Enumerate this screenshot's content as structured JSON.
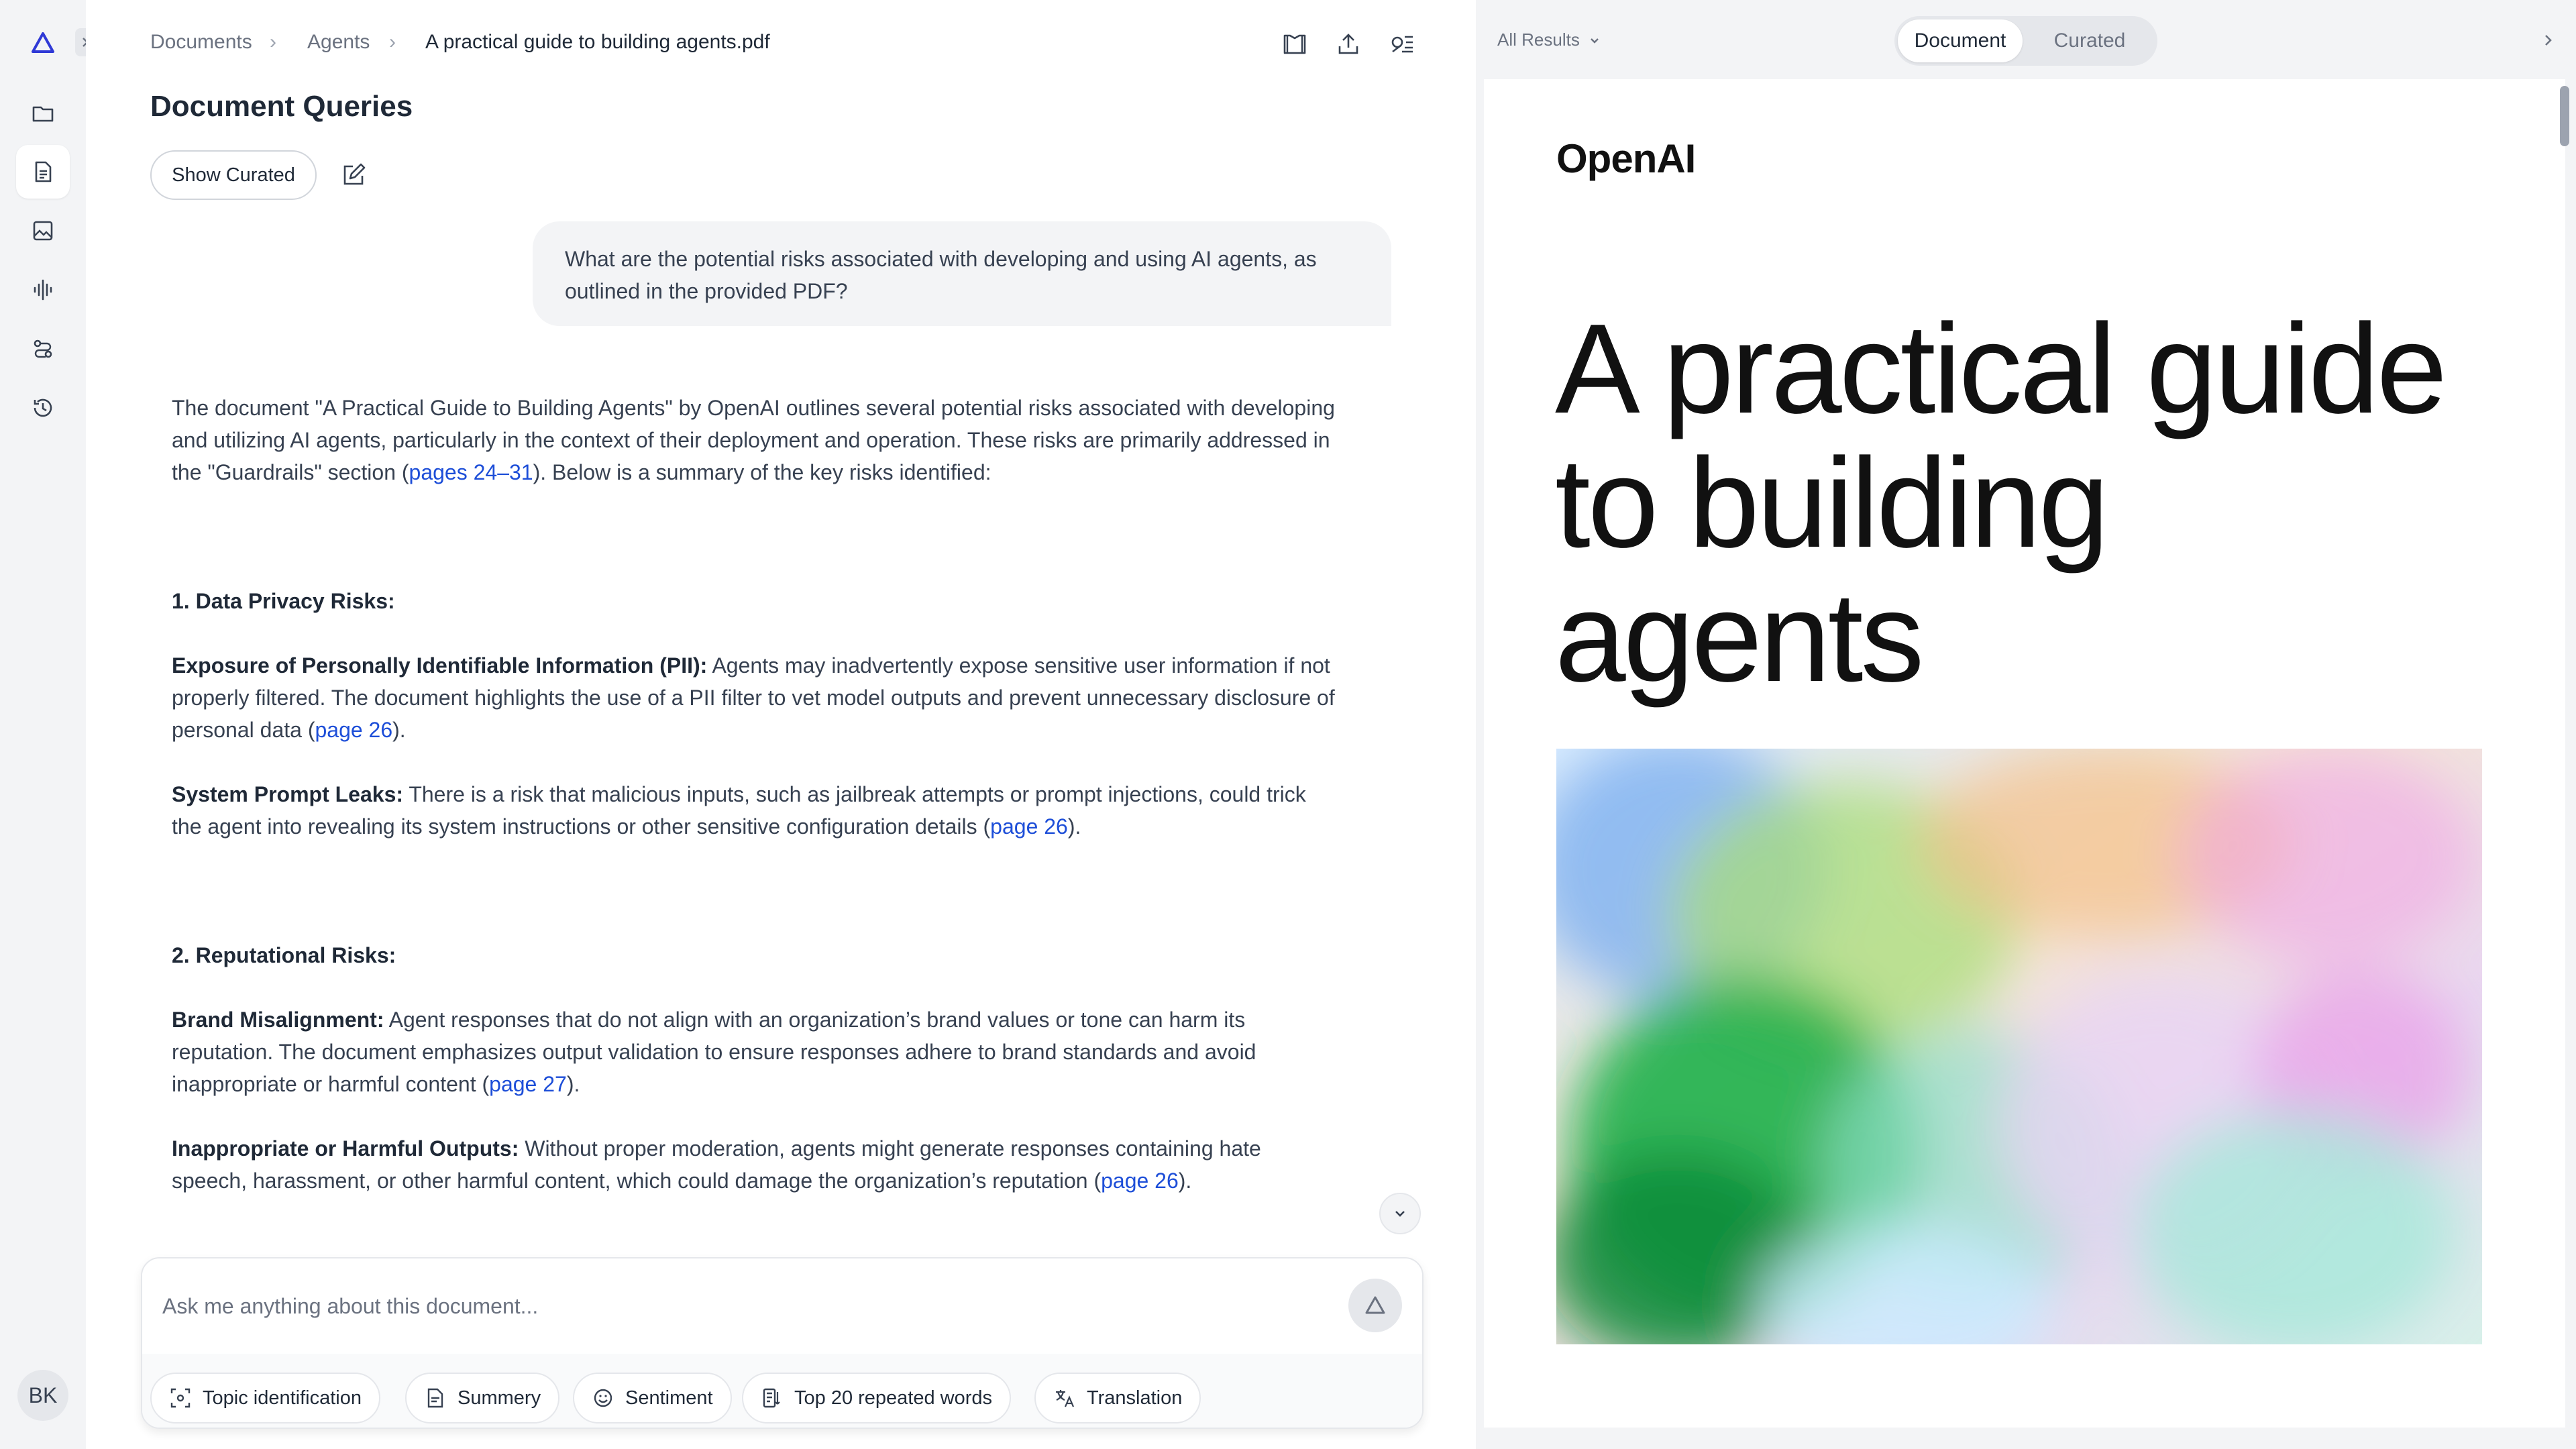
{
  "breadcrumb": {
    "items": [
      "Documents",
      "Agents"
    ],
    "current": "A practical guide to building agents.pdf"
  },
  "page_title": "Document Queries",
  "show_curated_label": "Show Curated",
  "user_query": "What are the potential risks associated with developing and using AI agents, as outlined in the provided PDF?",
  "answer": {
    "intro_pre": "The document \"A Practical Guide to Building Agents\" by OpenAI outlines several potential risks associated with developing and utilizing AI agents, particularly in the context of their deployment and operation. These risks are primarily addressed in the \"Guardrails\" section (",
    "intro_cite": "pages 24–31",
    "intro_post": "). Below is a summary of the key risks identified:",
    "sections": [
      {
        "heading": "1. Data Privacy Risks:",
        "items": [
          {
            "title": "Exposure of Personally Identifiable Information (PII):",
            "text": " Agents may inadvertently expose sensitive user information if not properly filtered. The document highlights the use of a PII filter to vet model outputs and prevent unnecessary disclosure of personal data (",
            "cite": "page 26",
            "end": ")."
          },
          {
            "title": "System Prompt Leaks:",
            "text": " There is a risk that malicious inputs, such as jailbreak attempts or prompt injections, could trick the agent into revealing its system instructions or other sensitive configuration details (",
            "cite": "page 26",
            "end": ")."
          }
        ]
      },
      {
        "heading": "2. Reputational Risks:",
        "items": [
          {
            "title": "Brand Misalignment:",
            "text": " Agent responses that do not align with an organization’s brand values or tone can harm its reputation. The document emphasizes output validation to ensure responses adhere to brand standards and avoid inappropriate or harmful content (",
            "cite": "page 27",
            "end": ")."
          },
          {
            "title": "Inappropriate or Harmful Outputs:",
            "text": " Without proper moderation, agents might generate responses containing hate speech, harassment, or other harmful content, which could damage the organization’s reputation (",
            "cite": "page 26",
            "end": ")."
          }
        ]
      }
    ]
  },
  "composer": {
    "placeholder": "Ask me anything about this document...",
    "chips": [
      "Topic identification",
      "Summery",
      "Sentiment",
      "Top 20 repeated words",
      "Translation"
    ]
  },
  "user": {
    "initials": "BK"
  },
  "viewer": {
    "filter_label": "All Results",
    "tabs": [
      "Document",
      "Curated"
    ],
    "active_tab": "Document",
    "pdf": {
      "logo": "OpenAI",
      "title": "A practical guide to building agents"
    }
  },
  "colors": {
    "accent": "#1d4ed8",
    "logo": "#2f39d6",
    "rail_bg": "#f3f4f6"
  }
}
